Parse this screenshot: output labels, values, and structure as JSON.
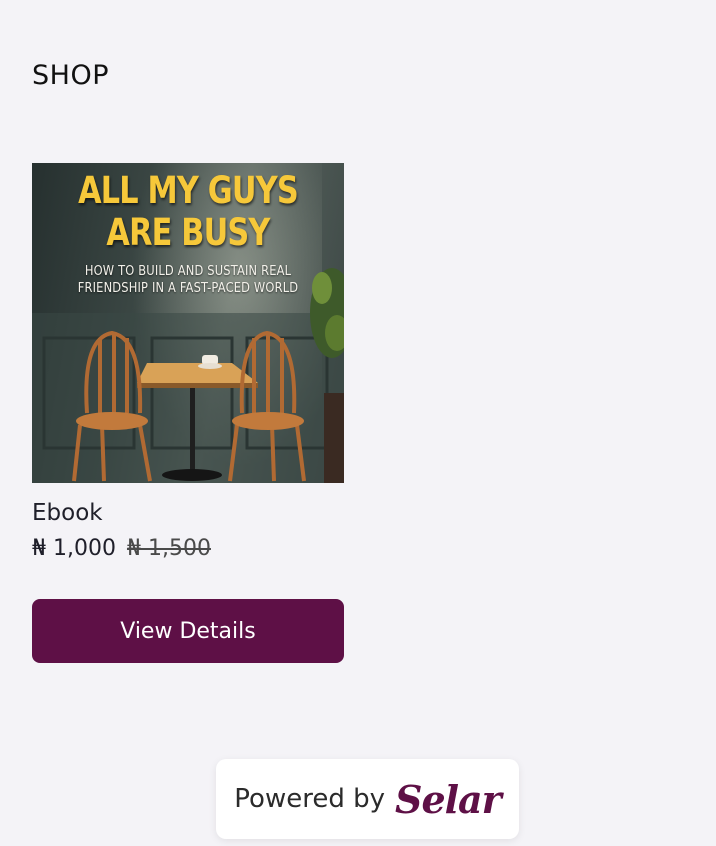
{
  "shop": {
    "heading": "SHOP"
  },
  "product": {
    "cover": {
      "title_line1": "ALL MY GUYS",
      "title_line2": "ARE BUSY",
      "subtitle_line1": "HOW TO BUILD AND SUSTAIN REAL",
      "subtitle_line2": "FRIENDSHIP IN A FAST-PACED WORLD"
    },
    "name": "Ebook",
    "price_current": "₦ 1,000",
    "price_original": "₦ 1,500",
    "button_label": "View Details"
  },
  "footer": {
    "powered_by": "Powered by",
    "brand": "Selar"
  },
  "colors": {
    "accent": "#5e1046",
    "background": "#f4f3f7",
    "cover_title": "#f6c83a"
  }
}
